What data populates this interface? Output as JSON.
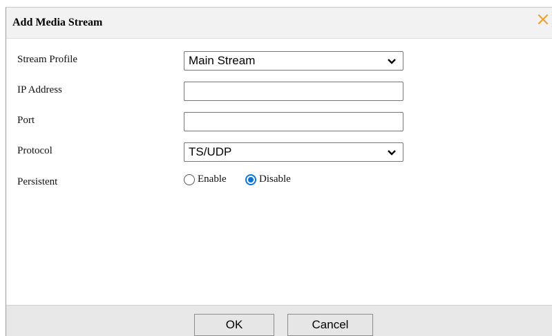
{
  "dialog": {
    "title": "Add Media Stream",
    "close_icon": "close-icon"
  },
  "form": {
    "stream_profile": {
      "label": "Stream Profile",
      "value": "Main Stream"
    },
    "ip_address": {
      "label": "IP Address",
      "value": ""
    },
    "port": {
      "label": "Port",
      "value": ""
    },
    "protocol": {
      "label": "Protocol",
      "value": "TS/UDP"
    },
    "persistent": {
      "label": "Persistent",
      "options": [
        "Enable",
        "Disable"
      ],
      "selected": "Disable"
    }
  },
  "footer": {
    "ok_label": "OK",
    "cancel_label": "Cancel"
  },
  "colors": {
    "accent": "#0a74da",
    "close": "#f0a030"
  }
}
